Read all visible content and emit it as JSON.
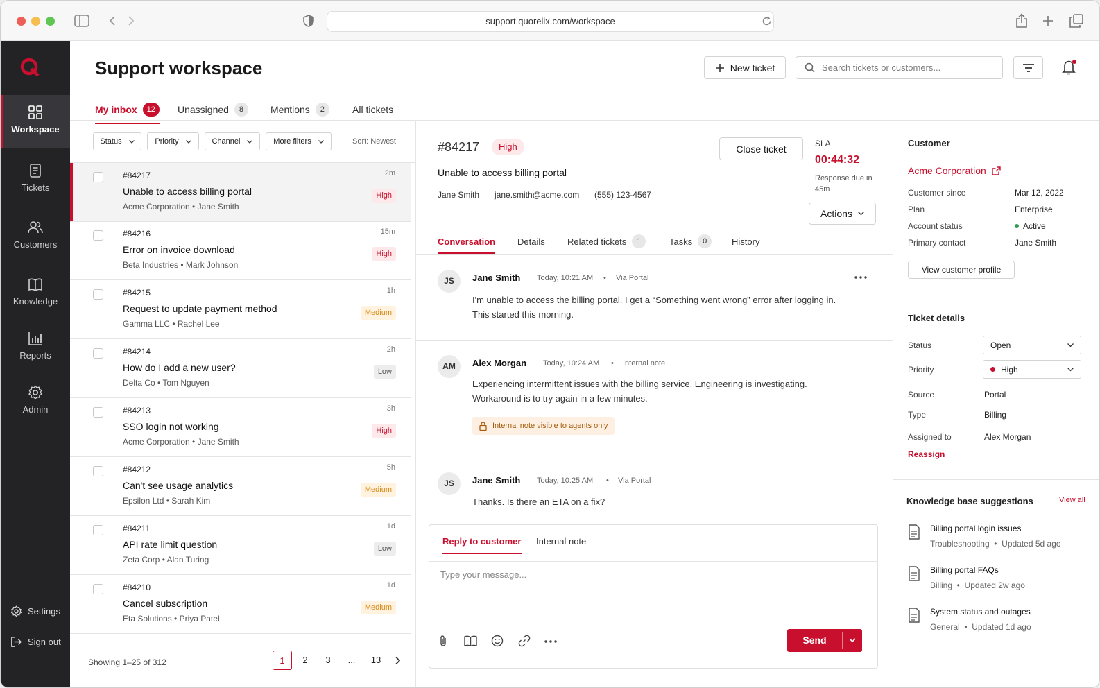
{
  "browser": {
    "url": "support.quorelix.com/workspace"
  },
  "sidebar": {
    "items": [
      {
        "label": "Workspace",
        "icon": "grid-icon"
      },
      {
        "label": "Tickets",
        "icon": "document-icon"
      },
      {
        "label": "Customers",
        "icon": "users-icon"
      },
      {
        "label": "Knowledge",
        "icon": "book-icon"
      },
      {
        "label": "Reports",
        "icon": "bar-chart-icon"
      },
      {
        "label": "Admin",
        "icon": "gear-icon"
      }
    ],
    "settings": "Settings",
    "signout": "Sign out"
  },
  "header": {
    "title": "Support workspace",
    "new_ticket": "New ticket",
    "search_placeholder": "Search tickets or customers..."
  },
  "tabs": [
    {
      "label": "My inbox",
      "count": "12"
    },
    {
      "label": "Unassigned",
      "count": "8"
    },
    {
      "label": "Mentions",
      "count": "2"
    },
    {
      "label": "All tickets",
      "count": ""
    }
  ],
  "filters": {
    "status": "Status",
    "priority": "Priority",
    "channel": "Channel",
    "more": "More filters",
    "sort": "Sort: Newest"
  },
  "tickets": [
    {
      "id": "#84217",
      "title": "Unable to access billing portal",
      "sub": "Acme Corporation • Jane Smith",
      "time": "2m",
      "priority": "High"
    },
    {
      "id": "#84216",
      "title": "Error on invoice download",
      "sub": "Beta Industries • Mark Johnson",
      "time": "15m",
      "priority": "High"
    },
    {
      "id": "#84215",
      "title": "Request to update payment method",
      "sub": "Gamma LLC • Rachel Lee",
      "time": "1h",
      "priority": "Medium"
    },
    {
      "id": "#84214",
      "title": "How do I add a new user?",
      "sub": "Delta Co • Tom Nguyen",
      "time": "2h",
      "priority": "Low"
    },
    {
      "id": "#84213",
      "title": "SSO login not working",
      "sub": "Acme Corporation • Jane Smith",
      "time": "3h",
      "priority": "High"
    },
    {
      "id": "#84212",
      "title": "Can't see usage analytics",
      "sub": "Epsilon Ltd • Sarah Kim",
      "time": "5h",
      "priority": "Medium"
    },
    {
      "id": "#84211",
      "title": "API rate limit question",
      "sub": "Zeta Corp • Alan Turing",
      "time": "1d",
      "priority": "Low"
    },
    {
      "id": "#84210",
      "title": "Cancel subscription",
      "sub": "Eta Solutions • Priya Patel",
      "time": "1d",
      "priority": "Medium"
    }
  ],
  "pagination": {
    "showing": "Showing 1–25 of 312",
    "pages": [
      "1",
      "2",
      "3",
      "...",
      "13"
    ]
  },
  "detail": {
    "id": "#84217",
    "priority": "High",
    "title": "Unable to access billing portal",
    "contact_name": "Jane Smith",
    "contact_email": "jane.smith@acme.com",
    "contact_phone": "(555) 123-4567",
    "close_ticket": "Close ticket",
    "actions": "Actions",
    "sla_label": "SLA",
    "sla_value": "00:44:32",
    "sla_desc": "Response due in 45m",
    "tabs": [
      {
        "label": "Conversation",
        "count": ""
      },
      {
        "label": "Details",
        "count": ""
      },
      {
        "label": "Related tickets",
        "count": "1"
      },
      {
        "label": "Tasks",
        "count": "0"
      },
      {
        "label": "History",
        "count": ""
      }
    ],
    "messages": [
      {
        "initials": "JS",
        "name": "Jane Smith",
        "time": "Today, 10:21 AM",
        "source": "Via Portal",
        "body": "I'm unable to access the billing portal. I get a “Something went wrong” error after logging in. This started this morning."
      },
      {
        "initials": "AM",
        "name": "Alex Morgan",
        "time": "Today, 10:24 AM",
        "source": "Internal note",
        "body": "Experiencing intermittent issues with the billing service. Engineering is investigating. Workaround is to try again in a few minutes.",
        "note": "Internal note visible to agents only"
      },
      {
        "initials": "JS",
        "name": "Jane Smith",
        "time": "Today, 10:25 AM",
        "source": "Via Portal",
        "body": "Thanks. Is there an ETA on a fix?"
      }
    ],
    "reply": {
      "tab_customer": "Reply to customer",
      "tab_internal": "Internal note",
      "placeholder": "Type your message...",
      "send": "Send"
    }
  },
  "customer": {
    "heading": "Customer",
    "name": "Acme Corporation",
    "fields": [
      {
        "label": "Customer since",
        "value": "Mar 12, 2022"
      },
      {
        "label": "Plan",
        "value": "Enterprise"
      },
      {
        "label": "Account status",
        "value": "Active"
      },
      {
        "label": "Primary contact",
        "value": "Jane Smith"
      }
    ],
    "view_profile": "View customer profile"
  },
  "ticket_details": {
    "heading": "Ticket details",
    "status_label": "Status",
    "status_value": "Open",
    "priority_label": "Priority",
    "priority_value": "High",
    "source_label": "Source",
    "source_value": "Portal",
    "type_label": "Type",
    "type_value": "Billing",
    "assigned_label": "Assigned to",
    "assigned_value": "Alex Morgan",
    "reassign": "Reassign"
  },
  "kb": {
    "heading": "Knowledge base suggestions",
    "view_all": "View all",
    "items": [
      {
        "title": "Billing portal login issues",
        "sub": "Troubleshooting  •  Updated 5d ago"
      },
      {
        "title": "Billing portal FAQs",
        "sub": "Billing  •  Updated 2w ago"
      },
      {
        "title": "System status and outages",
        "sub": "General  •  Updated 1d ago"
      }
    ]
  },
  "colors": {
    "accent": "#c8102e",
    "sidebar": "#232326",
    "active_green": "#2e9e4f"
  }
}
